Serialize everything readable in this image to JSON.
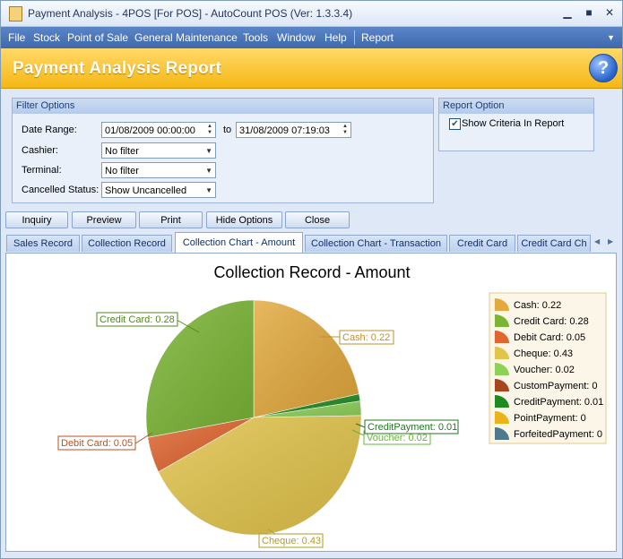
{
  "window": {
    "title": "Payment Analysis - 4POS [For POS] - AutoCount POS (Ver: 1.3.3.4)"
  },
  "menu": [
    "File",
    "Stock",
    "Point of Sale",
    "General Maintenance",
    "Tools",
    "Window",
    "Help",
    "Report"
  ],
  "banner": {
    "title": "Payment Analysis Report"
  },
  "filter": {
    "heading": "Filter Options",
    "date_range_label": "Date Range:",
    "date_from": "01/08/2009 00:00:00",
    "to_label": "to",
    "date_to": "31/08/2009 07:19:03",
    "cashier_label": "Cashier:",
    "cashier_value": "No filter",
    "terminal_label": "Terminal:",
    "terminal_value": "No filter",
    "cancelled_label": "Cancelled Status:",
    "cancelled_value": "Show Uncancelled"
  },
  "report_option": {
    "heading": "Report Option",
    "show_criteria_label": "Show Criteria In Report",
    "show_criteria_checked": true
  },
  "buttons": {
    "inquiry": "Inquiry",
    "preview": "Preview",
    "print": "Print",
    "hide_options": "Hide Options",
    "close": "Close"
  },
  "tabs": [
    "Sales Record",
    "Collection Record",
    "Collection Chart - Amount",
    "Collection Chart - Transaction",
    "Credit Card",
    "Credit Card Ch"
  ],
  "chart_data": {
    "type": "pie",
    "title": "Collection Record - Amount",
    "legend_position": "right",
    "slices": [
      {
        "label": "Cash",
        "value": 0.22,
        "color": "#e3a93c"
      },
      {
        "label": "Credit Card",
        "value": 0.28,
        "color": "#7ab534"
      },
      {
        "label": "Debit Card",
        "value": 0.05,
        "color": "#e0652f"
      },
      {
        "label": "Cheque",
        "value": 0.43,
        "color": "#e2c44a"
      },
      {
        "label": "Voucher",
        "value": 0.02,
        "color": "#8ed159"
      },
      {
        "label": "CustomPayment",
        "value": 0,
        "color": "#a8451c"
      },
      {
        "label": "CreditPayment",
        "value": 0.01,
        "color": "#1f8a1f"
      },
      {
        "label": "PointPayment",
        "value": 0,
        "color": "#e8b418"
      },
      {
        "label": "ForfeitedPayment",
        "value": 0,
        "color": "#4f7a8c"
      }
    ],
    "callouts": [
      {
        "text": "Cash: 0.22",
        "color": "#c38d2e"
      },
      {
        "text": "Credit Card: 0.28",
        "color": "#4f8a1c"
      },
      {
        "text": "Debit Card: 0.05",
        "color": "#b8501f"
      },
      {
        "text": "Cheque: 0.43",
        "color": "#b39a27"
      },
      {
        "text": "Voucher: 0.02",
        "color": "#6ab23c"
      },
      {
        "text": "CreditPayment: 0.01",
        "color": "#1f7a1f"
      }
    ],
    "legend_entries": [
      "Cash: 0.22",
      "Credit Card: 0.28",
      "Debit Card: 0.05",
      "Cheque: 0.43",
      "Voucher: 0.02",
      "CustomPayment: 0",
      "CreditPayment: 0.01",
      "PointPayment: 0",
      "ForfeitedPayment: 0"
    ]
  }
}
